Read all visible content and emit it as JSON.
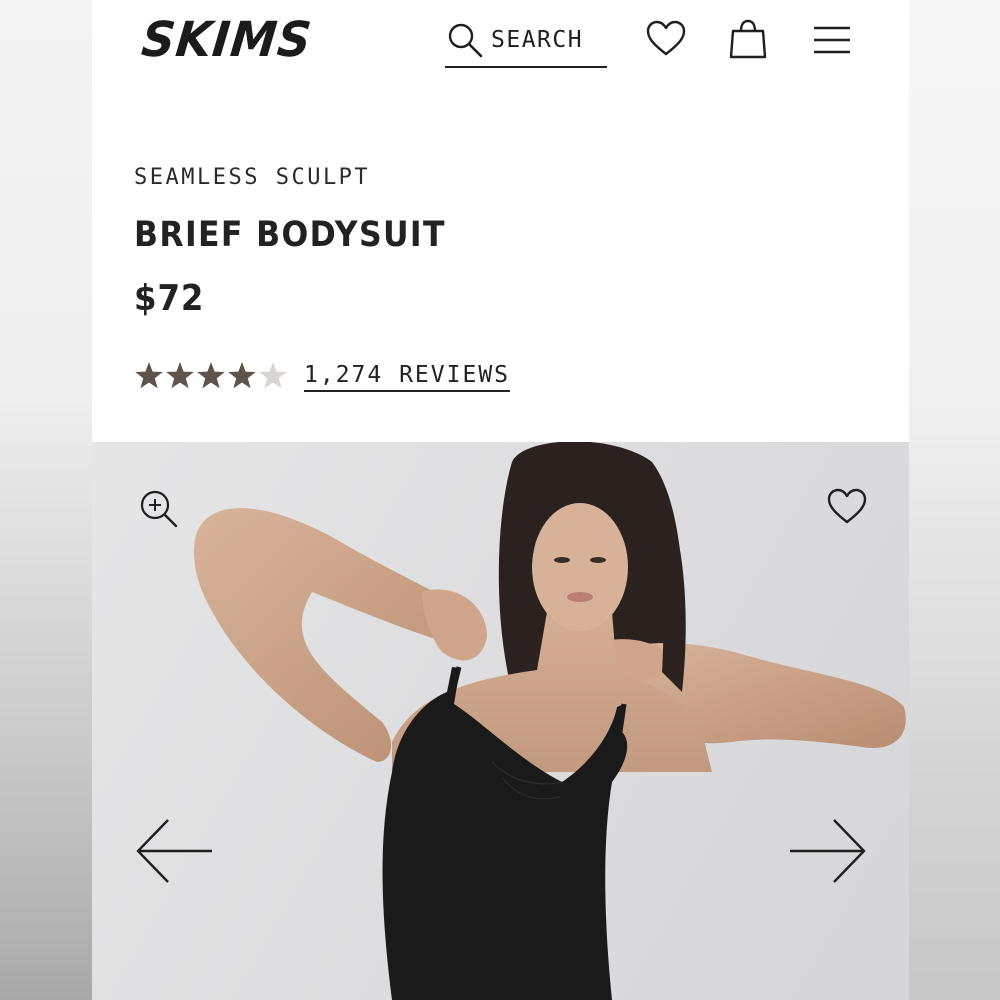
{
  "header": {
    "logo_text": "SKIMS",
    "search_label": "SEARCH",
    "icons": [
      "search-icon",
      "heart-icon",
      "shopping-bag-icon",
      "menu-icon"
    ]
  },
  "product": {
    "collection": "SEAMLESS SCULPT",
    "title": "BRIEF BODYSUIT",
    "price": "$72",
    "rating": 4.5,
    "rating_max": 5,
    "reviews_label": "1,274 REVIEWS"
  },
  "gallery": {
    "icons": [
      "zoom-in-icon",
      "heart-icon",
      "arrow-left-icon",
      "arrow-right-icon"
    ]
  },
  "colors": {
    "text": "#1f1f1f",
    "star": "#5d544b",
    "image_bg": "#dcdcde"
  }
}
